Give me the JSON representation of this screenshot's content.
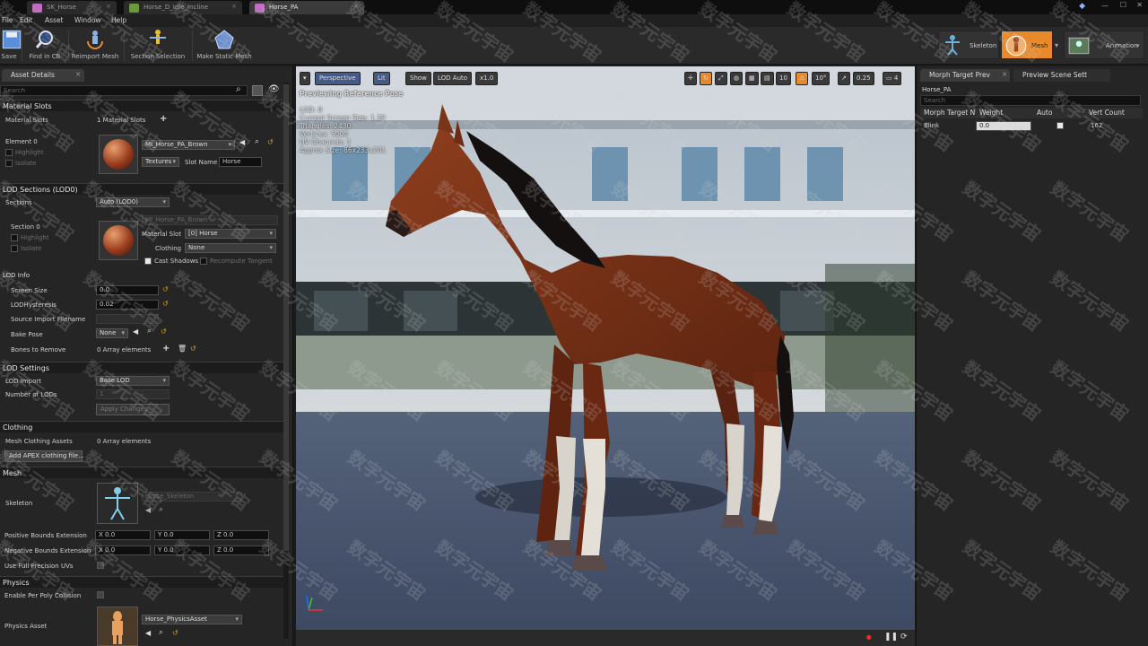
{
  "tabs": [
    {
      "label": "SK_Horse"
    },
    {
      "label": "Horse_D_Idle_Incline"
    },
    {
      "label": "Horse_PA"
    }
  ],
  "menu": [
    "File",
    "Edit",
    "Asset",
    "Window",
    "Help"
  ],
  "toolbar": {
    "save": "Save",
    "find_in_cb": "Find in CB",
    "reimport_mesh": "Reimport Mesh",
    "section_selection": "Section Selection",
    "make_static_mesh": "Make Static Mesh"
  },
  "modes": {
    "skeleton": "Skeleton",
    "mesh": "Mesh",
    "animation": "Animation"
  },
  "left_panel": {
    "tab": "Asset Details",
    "search_placeholder": "Search",
    "material_slots": {
      "header": "Material Slots",
      "label": "Material Slots",
      "count": "1 Material Slots",
      "element": "Element 0",
      "highlight": "Highlight",
      "isolate": "Isolate",
      "material": "MI_Horse_PA_Brown",
      "textures": "Textures",
      "slot_name_label": "Slot Name",
      "slot_name": "Horse"
    },
    "lod_sections": {
      "header": "LOD Sections (LOD0)",
      "sections_label": "Sections",
      "sections_value": "Auto (LOD0)",
      "section": "Section 0",
      "highlight": "Highlight",
      "isolate": "Isolate",
      "material_name": "MI_Horse_PA_Brown",
      "material_slot_label": "Material Slot",
      "material_slot_value": "[0] Horse",
      "clothing_label": "Clothing",
      "clothing_value": "None",
      "cast_shadows": "Cast Shadows",
      "recompute_tangent": "Recompute Tangent"
    },
    "lod_info": {
      "header": "LOD Info",
      "screen_size_label": "Screen Size",
      "screen_size": "0.0",
      "hysteresis_label": "LODHysteresis",
      "hysteresis": "0.02",
      "source_import_label": "Source Import Filename",
      "bake_pose_label": "Bake Pose",
      "bake_pose": "None",
      "bones_remove_label": "Bones to Remove",
      "bones_remove": "0 Array elements"
    },
    "lod_settings": {
      "header": "LOD Settings",
      "lod_import_label": "LOD Import",
      "lod_import": "Base LOD",
      "num_lods_label": "Number of LODs",
      "num_lods": "1",
      "apply": "Apply Changes"
    },
    "clothing": {
      "header": "Clothing",
      "assets_label": "Mesh Clothing Assets",
      "assets_value": "0 Array elements",
      "add_apex": "Add APEX clothing file..."
    },
    "mesh": {
      "header": "Mesh",
      "skeleton_label": "Skeleton",
      "skeleton_value": "Horse_Skeleton",
      "pos_bounds_label": "Positive Bounds Extension",
      "neg_bounds_label": "Negative Bounds Extension",
      "pos_x": "X 0.0",
      "pos_y": "Y 0.0",
      "pos_z": "Z 0.0",
      "neg_x": "X 0.0",
      "neg_y": "Y 0.0",
      "neg_z": "Z 0.0",
      "full_precision_label": "Use Full Precision UVs"
    },
    "physics": {
      "header": "Physics",
      "per_poly_label": "Enable Per Poly Collision",
      "physics_asset_label": "Physics Asset",
      "physics_asset_value": "Horse_PhysicsAsset"
    }
  },
  "viewport": {
    "perspective": "Perspective",
    "lit": "Lit",
    "show": "Show",
    "lod_auto": "LOD Auto",
    "speed": "x1.0",
    "grid_snap": "10",
    "rot_snap": "10°",
    "scale_snap": "0.25",
    "cam_speed": "4",
    "previewing": "Previewing Reference Pose",
    "stats": [
      "LOD: 0",
      "Current Screen Size: 1.39",
      "Triangles: 2430",
      "Vertices: 5000",
      "UV Channels: 1",
      "Approx Size: 86x233x201"
    ]
  },
  "right_panel": {
    "tab_morph": "Morph Target Prev",
    "tab_scene": "Preview Scene Sett",
    "asset_name": "Horse_PA",
    "search_placeholder": "Search",
    "col_morph": "Morph Target N",
    "col_weight": "Weight",
    "col_auto": "Auto",
    "col_vert": "Vert Count",
    "row_name": "Blink",
    "row_weight": "0.0",
    "row_vert": "162"
  },
  "watermark": "数字元宇宙",
  "colors": {
    "accent_orange": "#e8892a",
    "viewport_blue": "#455a88"
  }
}
